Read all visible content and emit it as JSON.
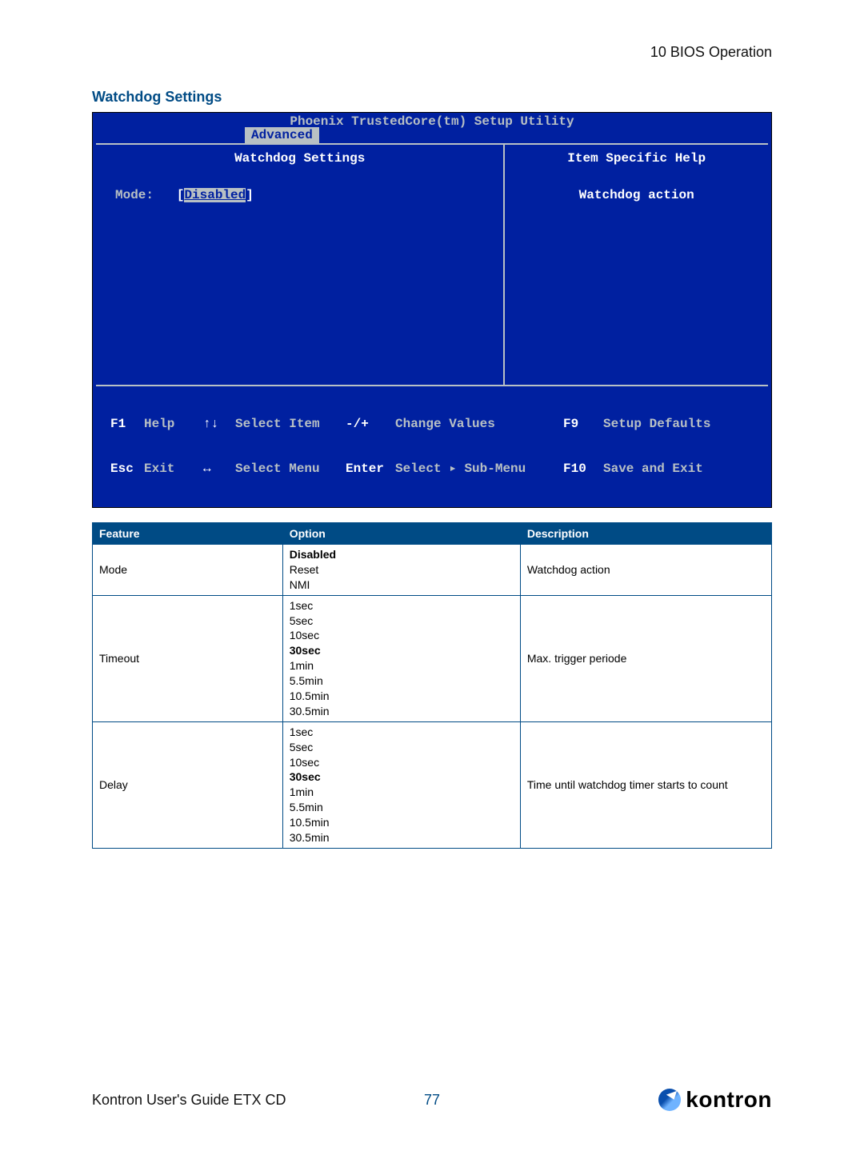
{
  "chapter": "10 BIOS Operation",
  "section_title": "Watchdog Settings",
  "bios": {
    "header": "Phoenix TrustedCore(tm) Setup Utility",
    "tab": "Advanced",
    "panel_title": "Watchdog Settings",
    "help_title": "Item Specific Help",
    "field_label": "Mode:",
    "field_value": "Disabled",
    "help_text": "Watchdog action",
    "footer": {
      "r1": {
        "k1": "F1",
        "l1": "Help",
        "a1": "↑↓",
        "s1": "Select Item",
        "pm": "-/+",
        "cv": "Change Values",
        "k2": "F9",
        "l2": "Setup Defaults"
      },
      "r2": {
        "k1": "Esc",
        "l1": "Exit",
        "a1": "↔",
        "s1": "Select Menu",
        "pm": "Enter",
        "cv": "Select ▸ Sub-Menu",
        "k2": "F10",
        "l2": "Save and Exit"
      }
    }
  },
  "table": {
    "headers": {
      "c1": "Feature",
      "c2": "Option",
      "c3": "Description"
    },
    "rows": [
      {
        "feature": "Mode",
        "options": [
          {
            "text": "Disabled",
            "bold": true
          },
          {
            "text": "Reset",
            "bold": false
          },
          {
            "text": "NMI",
            "bold": false
          }
        ],
        "desc": "Watchdog action"
      },
      {
        "feature": "Timeout",
        "options": [
          {
            "text": "1sec",
            "bold": false
          },
          {
            "text": "5sec",
            "bold": false
          },
          {
            "text": "10sec",
            "bold": false
          },
          {
            "text": "30sec",
            "bold": true
          },
          {
            "text": "1min",
            "bold": false
          },
          {
            "text": "5.5min",
            "bold": false
          },
          {
            "text": "10.5min",
            "bold": false
          },
          {
            "text": "30.5min",
            "bold": false
          }
        ],
        "desc": "Max. trigger periode"
      },
      {
        "feature": "Delay",
        "options": [
          {
            "text": "1sec",
            "bold": false
          },
          {
            "text": "5sec",
            "bold": false
          },
          {
            "text": "10sec",
            "bold": false
          },
          {
            "text": "30sec",
            "bold": true
          },
          {
            "text": "1min",
            "bold": false
          },
          {
            "text": "5.5min",
            "bold": false
          },
          {
            "text": "10.5min",
            "bold": false
          },
          {
            "text": "30.5min",
            "bold": false
          }
        ],
        "desc": "Time until watchdog timer starts to count"
      }
    ]
  },
  "footer": {
    "guide": "Kontron User's Guide ETX CD",
    "page": "77",
    "brand": "kontron"
  }
}
